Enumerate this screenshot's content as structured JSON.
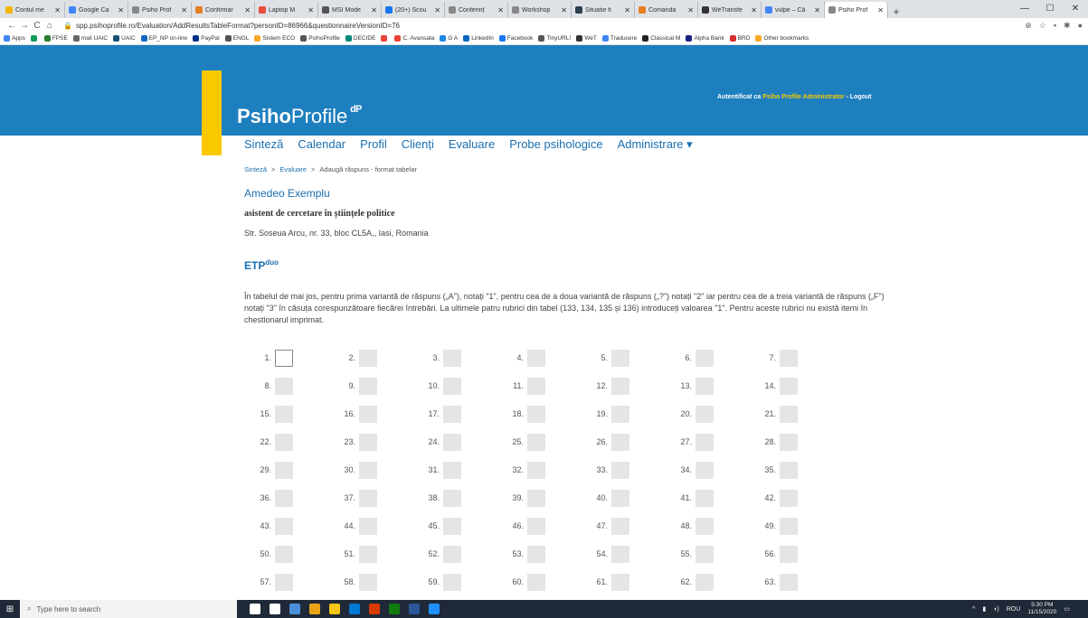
{
  "tabs": [
    {
      "label": "Contul me",
      "color": "#f4b400"
    },
    {
      "label": "Google Ca",
      "color": "#4285f4"
    },
    {
      "label": "Psiho Prof",
      "color": "#888"
    },
    {
      "label": "Confirmar",
      "color": "#e67e22"
    },
    {
      "label": "Laptop M",
      "color": "#e74c3c"
    },
    {
      "label": "MSI Mode",
      "color": "#555"
    },
    {
      "label": "(20+) Scou",
      "color": "#1877f2"
    },
    {
      "label": "Conferinț",
      "color": "#888"
    },
    {
      "label": "Workshop",
      "color": "#888"
    },
    {
      "label": "Situatie fi",
      "color": "#2c3e50"
    },
    {
      "label": "Comanda",
      "color": "#e67e22"
    },
    {
      "label": "WeTransfe",
      "color": "#333"
    },
    {
      "label": "vulpe – Cä",
      "color": "#4285f4"
    },
    {
      "label": "Psiho Prof",
      "color": "#888"
    }
  ],
  "window_controls": {
    "minimize": "—",
    "maximize": "☐",
    "close": "✕"
  },
  "address": {
    "url": "spp.psihoprofile.ro/Evaluation/AddResultsTableFormat?personID=86966&questionnaireVersionID=76"
  },
  "bookmarks": [
    {
      "label": "Apps",
      "color": "#4285f4"
    },
    {
      "label": "",
      "color": "#0f9d58"
    },
    {
      "label": "FPSE",
      "color": "#2e7d32"
    },
    {
      "label": "mail UAIC",
      "color": "#666"
    },
    {
      "label": "UAIC",
      "color": "#1a5276"
    },
    {
      "label": "EP_NP on-line",
      "color": "#1565c0"
    },
    {
      "label": "PayPal",
      "color": "#003087"
    },
    {
      "label": "ENGL",
      "color": "#555"
    },
    {
      "label": "Sistem ECO",
      "color": "#f9a825"
    },
    {
      "label": "PsihoProfile",
      "color": "#555"
    },
    {
      "label": "DECIDE",
      "color": "#00897b"
    },
    {
      "label": "",
      "color": "#ea4335"
    },
    {
      "label": "C. Avansata",
      "color": "#ea4335"
    },
    {
      "label": "G A",
      "color": "#1e88e5"
    },
    {
      "label": "LinkedIn",
      "color": "#0a66c2"
    },
    {
      "label": "Facebook",
      "color": "#1877f2"
    },
    {
      "label": "TinyURL!",
      "color": "#555"
    },
    {
      "label": "WeT",
      "color": "#333"
    },
    {
      "label": "Traducere",
      "color": "#4285f4"
    },
    {
      "label": "Classical M",
      "color": "#222"
    },
    {
      "label": "Alpha Bank",
      "color": "#1a237e"
    },
    {
      "label": "BRD",
      "color": "#d32f2f"
    },
    {
      "label": "Other bookmarks",
      "color": "#f9a825"
    }
  ],
  "site": {
    "logo_bold": "Psiho",
    "logo_rest": "Profile",
    "auth_prefix": "Autentificat ca",
    "auth_user": "Psiho Profile Administrator",
    "auth_logout": "- Logout"
  },
  "menu": [
    "Sinteză",
    "Calendar",
    "Profil",
    "Clienți",
    "Evaluare",
    "Probe psihologice",
    "Administrare ▾"
  ],
  "breadcrumb": {
    "home": "Sinteză",
    "sep": ">",
    "section": "Evaluare",
    "current": "Adaugă răspuns - format tabelar"
  },
  "person": {
    "name": "Amedeo Exemplu",
    "role": "asistent de cercetare în științele politice",
    "address": "Str. Soseua Arcu, nr. 33, bloc CL5A,, Iasi, Romania"
  },
  "questionnaire": {
    "title": "ETP",
    "superscript": "duo",
    "instructions": "În tabelul de mai jos, pentru prima variantă de răspuns („A\"), notați \"1\", pentru cea de a doua variantă de răspuns („?\") notați \"2\" iar pentru cea de a treia variantă de răspuns („F\") notați \"3\" în căsuța corespunzătoare fiecărei întrebări. La ultimele patru rubrici din tabel (133, 134, 135 și 136) introduceți valoarea \"1\". Pentru aceste rubrici nu există itemi în chestionarul imprimat."
  },
  "answers": {
    "columns": 7,
    "visible_items": [
      "1.",
      "2.",
      "3.",
      "4.",
      "5.",
      "6.",
      "7.",
      "8.",
      "9.",
      "10.",
      "11.",
      "12.",
      "13.",
      "14.",
      "15.",
      "16.",
      "17.",
      "18.",
      "19.",
      "20.",
      "21.",
      "22.",
      "23.",
      "24.",
      "25.",
      "26.",
      "27.",
      "28.",
      "29.",
      "30.",
      "31.",
      "32.",
      "33.",
      "34.",
      "35.",
      "36.",
      "37.",
      "38.",
      "39.",
      "40.",
      "41.",
      "42.",
      "43.",
      "44.",
      "45.",
      "46.",
      "47.",
      "48.",
      "49.",
      "50.",
      "51.",
      "52.",
      "53.",
      "54.",
      "55.",
      "56.",
      "57.",
      "58.",
      "59.",
      "60.",
      "61.",
      "62.",
      "63."
    ]
  },
  "taskbar": {
    "search_placeholder": "Type here to search",
    "apps": [
      "#fff",
      "#fff",
      "#4a90d9",
      "#e8a317",
      "#f5c518",
      "#0078d4",
      "#d83b01",
      "#107c10",
      "#2b579a",
      "#1e90ff"
    ],
    "lang": "ROU",
    "time": "5:30 PM",
    "date": "11/15/2020"
  }
}
